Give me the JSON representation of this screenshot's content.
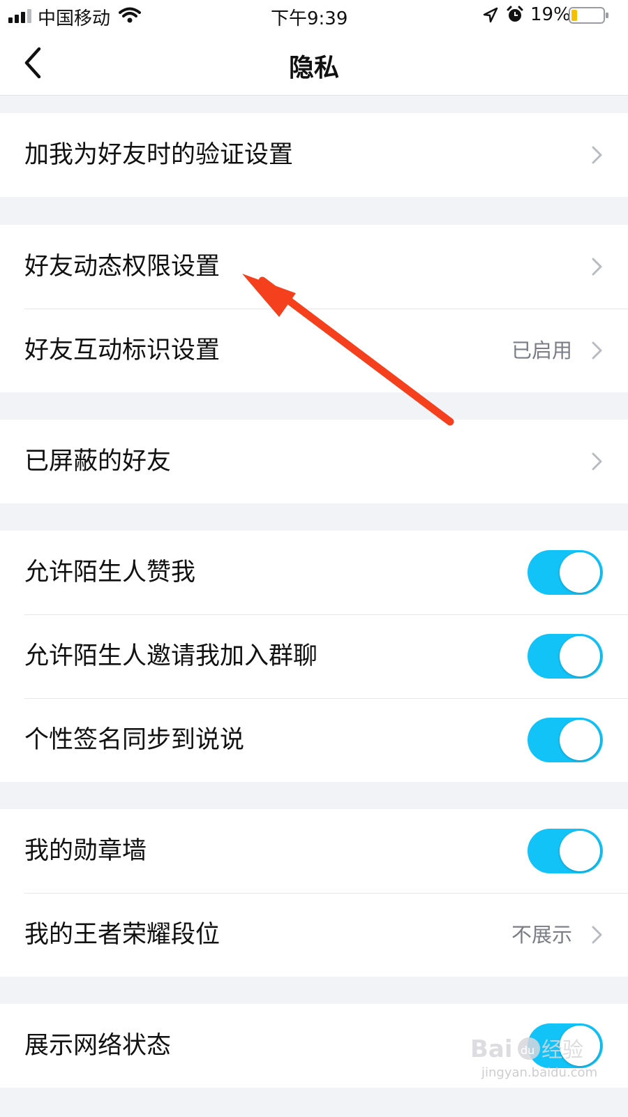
{
  "status_bar": {
    "carrier": "中国移动",
    "time": "下午9:39",
    "battery_percent": "19%",
    "battery_level": 0.19,
    "icons": [
      "signal-icon",
      "wifi-icon",
      "location-arrow-icon",
      "alarm-clock-icon",
      "battery-icon"
    ]
  },
  "header": {
    "title": "隐私",
    "back_icon": "chevron-left-icon"
  },
  "sections": [
    {
      "rows": [
        {
          "label": "加我为好友时的验证设置",
          "control": "chevron"
        }
      ]
    },
    {
      "rows": [
        {
          "label": "好友动态权限设置",
          "control": "chevron"
        },
        {
          "label": "好友互动标识设置",
          "value": "已启用",
          "control": "chevron"
        }
      ]
    },
    {
      "rows": [
        {
          "label": "已屏蔽的好友",
          "control": "chevron"
        }
      ]
    },
    {
      "rows": [
        {
          "label": "允许陌生人赞我",
          "control": "toggle",
          "on": true
        },
        {
          "label": "允许陌生人邀请我加入群聊",
          "control": "toggle",
          "on": true
        },
        {
          "label": "个性签名同步到说说",
          "control": "toggle",
          "on": true
        }
      ]
    },
    {
      "rows": [
        {
          "label": "我的勋章墙",
          "control": "toggle",
          "on": true
        },
        {
          "label": "我的王者荣耀段位",
          "value": "不展示",
          "control": "chevron"
        }
      ]
    },
    {
      "rows": [
        {
          "label": "展示网络状态",
          "control": "toggle",
          "on": true
        }
      ]
    }
  ],
  "colors": {
    "toggle_on": "#12c3f8",
    "annotation_arrow": "#f5401d",
    "secondary_text": "#7a7d85",
    "page_background": "#f2f3f6"
  },
  "watermark": {
    "logo": "Baidu经验",
    "url": "jingyan.baidu.com"
  }
}
